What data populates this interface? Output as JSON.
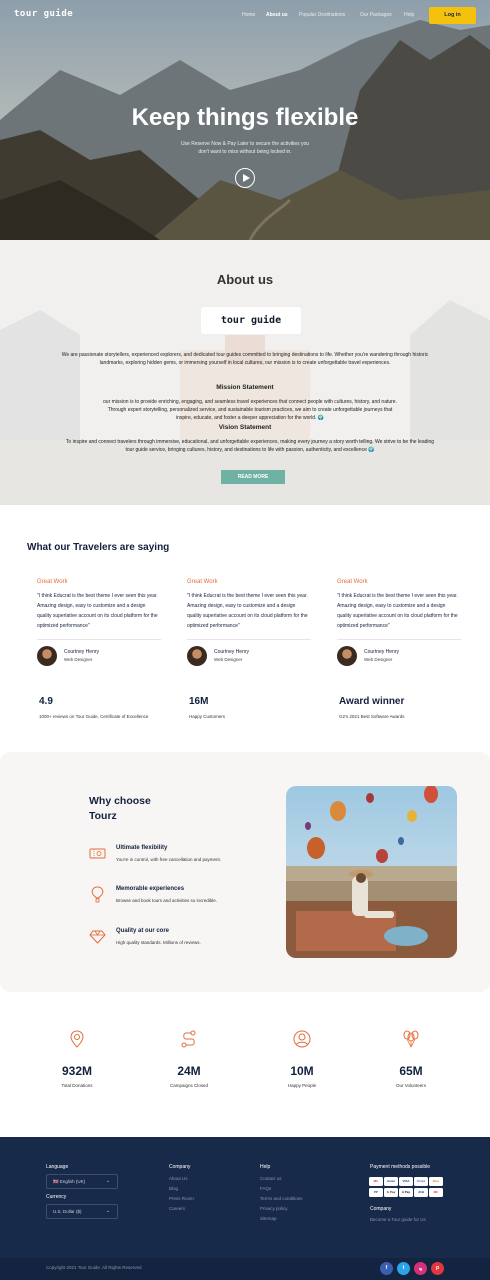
{
  "nav": {
    "logo": "tour guide",
    "links": [
      "Home",
      "About us",
      "Popular Destinations",
      "Our Packages",
      "Help"
    ],
    "active": "About us",
    "login_label": "Log in",
    "login_color": "#f4c20d"
  },
  "hero": {
    "title": "Keep things flexible",
    "subtitle": "Use Reserve Now & Pay Later to secure the activities you don't want to miss without being locked in.",
    "play_icon": "play-icon"
  },
  "about": {
    "title": "About us",
    "logo": "tour guide",
    "intro": "We are passionate storytellers, experienced explorers, and dedicated tour guides committed to bringing destinations to life. Whether you're wandering through historic landmarks, exploring hidden gems, or immersing yourself in local cultures, our mission is to create unforgettable travel experiences.",
    "mission_title": "Mission Statement",
    "mission_text": "our mission is to provide enriching, engaging, and seamless travel experiences that connect people with cultures, history, and nature. Through expert storytelling, personalized service, and sustainable tourism practices, we aim to create unforgettable journeys that inspire, educate, and foster a deeper appreciation for the world. 🌍",
    "vision_title": "Vision Statement",
    "vision_text": "To inspire and connect travelers through immersive, educational, and unforgettable experiences, making every journey a story worth telling. We strive to be the leading tour guide service, bringing cultures, history, and destinations to life with passion, authenticity, and excellence 🌍",
    "read_more": "READ MORE",
    "accent": "#6fb1a3"
  },
  "testimonials": {
    "title": "What our Travelers are saying",
    "cards": [
      {
        "heading": "Great Work",
        "quote": "\"I think Educrat is the best theme I ever seen this year. Amazing design, easy to customize and a design quality superlative account on its cloud platform for the optimized performance\"",
        "name": "Courtney Henry",
        "role": "Web Designer"
      },
      {
        "heading": "Great Work",
        "quote": "\"I think Educrat is the best theme I ever seen this year. Amazing design, easy to customize and a design quality superlative account on its cloud platform for the optimized performance\"",
        "name": "Courtney Henry",
        "role": "Web Designer"
      },
      {
        "heading": "Great Work",
        "quote": "\"I think Educrat is the best theme I ever seen this year. Amazing design, easy to customize and a design quality superlative account on its cloud platform for the optimized performance\"",
        "name": "Courtney Henry",
        "role": "Web Designer"
      }
    ],
    "stats": [
      {
        "value": "4.9",
        "label": "1000+ reviews on Tour Guide, Certificate of Excellence"
      },
      {
        "value": "16M",
        "label": "Happy Customers"
      },
      {
        "value": "Award winner",
        "label": "G2's 2021 Best Software Awards"
      }
    ]
  },
  "why": {
    "title": "Why choose Tourz",
    "items": [
      {
        "icon": "ticket-icon",
        "heading": "Ultimate flexibility",
        "text": "You're in control, with free cancellation and payment."
      },
      {
        "icon": "hot-air-balloon-icon",
        "heading": "Memorable experiences",
        "text": "Browse and book tours and activities so incredible."
      },
      {
        "icon": "diamond-icon",
        "heading": "Quality at our core",
        "text": "High quality standards. Millions of reviews."
      }
    ],
    "icon_color": "#e36d3c"
  },
  "counters": [
    {
      "icon": "location-pin-icon",
      "value": "932M",
      "label": "Total Donations"
    },
    {
      "icon": "route-icon",
      "value": "24M",
      "label": "Campaigns Closed"
    },
    {
      "icon": "user-icon",
      "value": "10M",
      "label": "Happy People"
    },
    {
      "icon": "balloons-icon",
      "value": "65M",
      "label": "Our Volunteers"
    }
  ],
  "footer": {
    "language_label": "Language",
    "language_value": "🇬🇧 English (UK)",
    "currency_label": "Currency",
    "currency_value": "U.S. Dollar ($)",
    "company_title": "Company",
    "company_links": [
      "About Us",
      "Blog",
      "Press Room",
      "Careers"
    ],
    "help_title": "Help",
    "help_links": [
      "Contact us",
      "FAQs",
      "Terms and conditions",
      "Privacy policy",
      "Sitemap"
    ],
    "payment_title": "Payment methods possible",
    "payment_methods": [
      "MC",
      "Amex",
      "VISA",
      "Stripe",
      "Disc",
      "PP",
      "G Pay",
      "A Pay",
      "JCB",
      "MC"
    ],
    "company2_title": "Company",
    "become_guide": "Become a Tour guide for Us",
    "copyright": "Copyright 2021 Tour Guide. All Rights Reserved",
    "social": [
      "f",
      "t",
      "ig",
      "p"
    ],
    "bg_color": "#182a4a"
  }
}
